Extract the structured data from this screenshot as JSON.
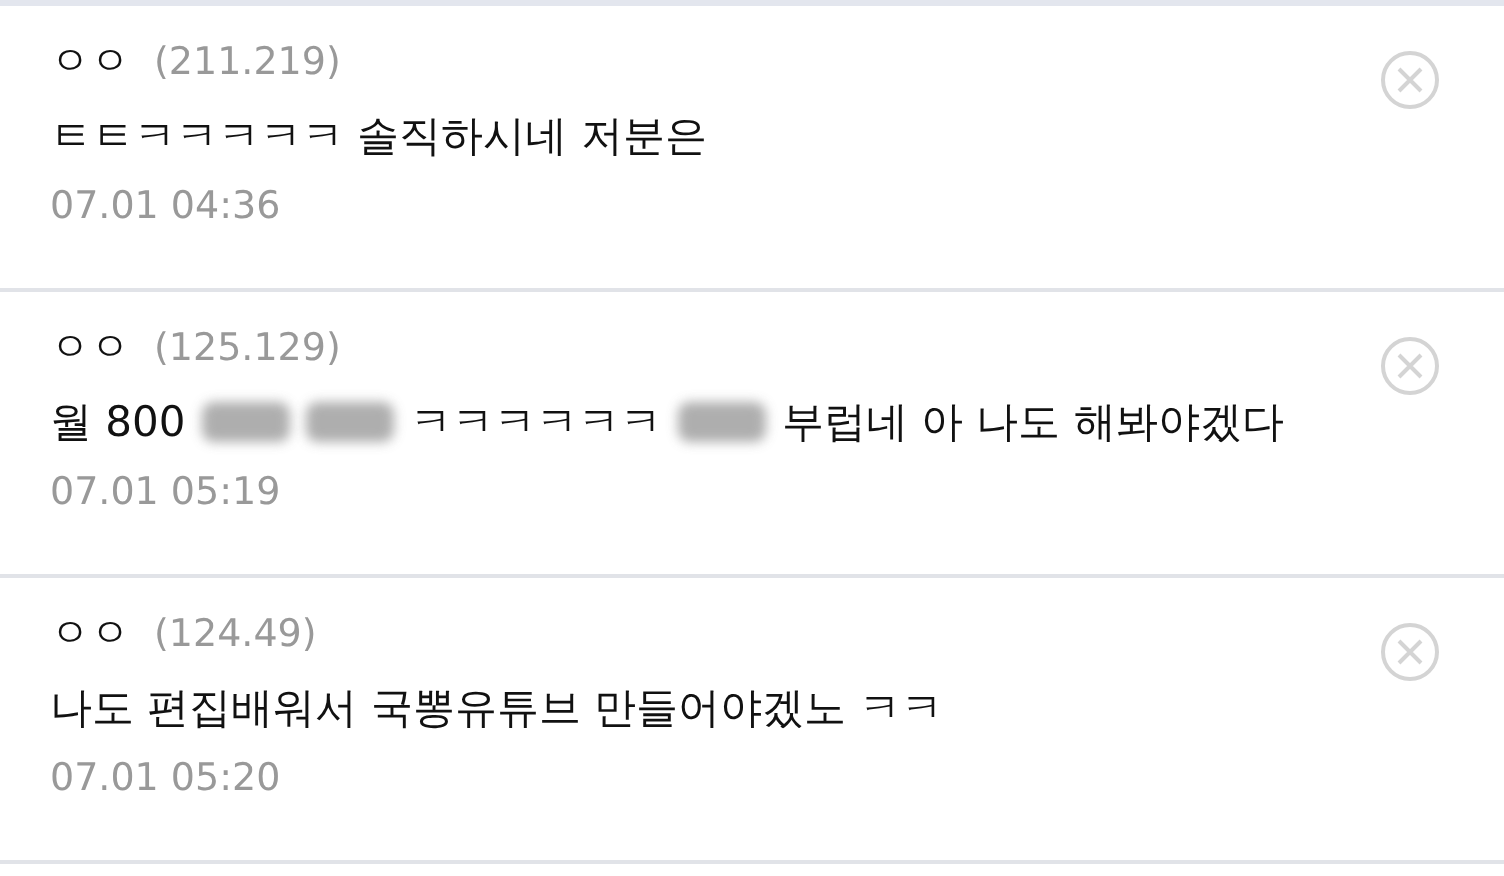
{
  "comments": [
    {
      "nickname": "ㅇㅇ",
      "ip": "(211.219)",
      "segments": [
        {
          "kind": "text",
          "text": "ㅌㅌㅋㅋㅋㅋㅋ 솔직하시네 저분은"
        }
      ],
      "time": "07.01 04:36"
    },
    {
      "nickname": "ㅇㅇ",
      "ip": "(125.129)",
      "segments": [
        {
          "kind": "text",
          "text": "월 800"
        },
        {
          "kind": "blurred"
        },
        {
          "kind": "blurred"
        },
        {
          "kind": "text",
          "text": "ㅋㅋㅋㅋㅋㅋ"
        },
        {
          "kind": "blurred"
        },
        {
          "kind": "text",
          "text": "부럽네 아 나도 해봐야겠다"
        }
      ],
      "time": "07.01 05:19"
    },
    {
      "nickname": "ㅇㅇ",
      "ip": "(124.49)",
      "segments": [
        {
          "kind": "text",
          "text": "나도 편집배워서 국뽕유튜브 만들어야겠노 ㅋㅋ"
        }
      ],
      "time": "07.01 05:20"
    }
  ]
}
